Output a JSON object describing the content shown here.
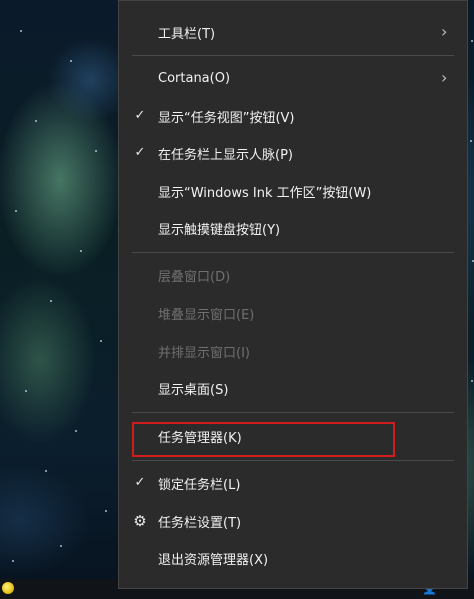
{
  "context_menu": {
    "items": [
      {
        "label": "工具栏(T)",
        "submenu": true,
        "checked": false,
        "enabled": true
      },
      {
        "label": "Cortana(O)",
        "submenu": true,
        "checked": false,
        "enabled": true
      },
      {
        "label": "显示“任务视图”按钮(V)",
        "checked": true,
        "enabled": true
      },
      {
        "label": "在任务栏上显示人脉(P)",
        "checked": true,
        "enabled": true
      },
      {
        "label": "显示“Windows Ink 工作区”按钮(W)",
        "checked": false,
        "enabled": true
      },
      {
        "label": "显示触摸键盘按钮(Y)",
        "checked": false,
        "enabled": true
      },
      {
        "label": "层叠窗口(D)",
        "checked": false,
        "enabled": false
      },
      {
        "label": "堆叠显示窗口(E)",
        "checked": false,
        "enabled": false
      },
      {
        "label": "并排显示窗口(I)",
        "checked": false,
        "enabled": false
      },
      {
        "label": "显示桌面(S)",
        "checked": false,
        "enabled": true
      },
      {
        "label": "任务管理器(K)",
        "checked": false,
        "enabled": true,
        "highlighted": true
      },
      {
        "label": "锁定任务栏(L)",
        "checked": true,
        "enabled": true
      },
      {
        "label": "任务栏设置(T)",
        "icon": "gear-icon",
        "enabled": true
      },
      {
        "label": "退出资源管理器(X)",
        "checked": false,
        "enabled": true
      }
    ]
  },
  "colors": {
    "menu_bg": "#2b2b2b",
    "highlight_border": "#d01c1c",
    "disabled_text": "#6f6f6f"
  }
}
